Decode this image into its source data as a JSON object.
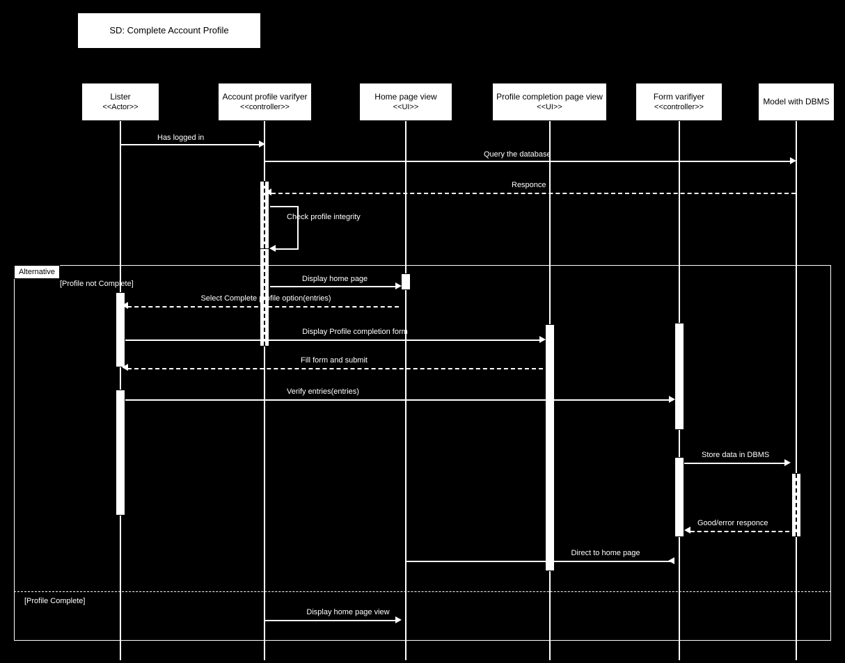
{
  "title": "SD: Complete Account Profile",
  "participants": {
    "lister": {
      "name": "Lister",
      "stereotype": "<<Actor>>"
    },
    "apv": {
      "name": "Account profile varifyer",
      "stereotype": "<<controller>>"
    },
    "home": {
      "name": "Home page view",
      "stereotype": "<<UI>>"
    },
    "pcp": {
      "name": "Profile completion page view",
      "stereotype": "<<UI>>"
    },
    "fv": {
      "name": "Form varifiyer",
      "stereotype": "<<controller>>"
    },
    "model": {
      "name": "Model with DBMS",
      "stereotype": ""
    }
  },
  "messages": {
    "m1": "Has logged in",
    "m2": "Query the database",
    "m3": "Responce",
    "m4": "Check profile integrity",
    "alt_label": "Alternative",
    "cond1": "[Profile not Complete]",
    "cond2": "[Profile Complete]",
    "m5": "Display home page",
    "m6": "Select Complete profile option(entries)",
    "m7": "Display Profile completion form",
    "m8": "Fill form and submit",
    "m9": "Verify entries(entries)",
    "m10": "Store data in DBMS",
    "m11": "Good/error responce",
    "m12": "Direct to home page",
    "m13": "Display home page view"
  }
}
